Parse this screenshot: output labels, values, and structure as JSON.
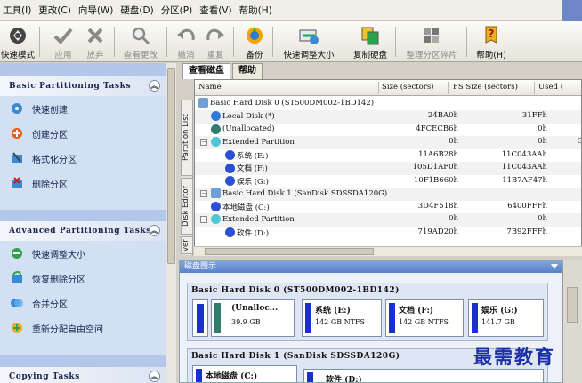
{
  "menu": [
    "工具(I)",
    "更改(C)",
    "向导(W)",
    "硬盘(D)",
    "分区(P)",
    "查看(V)",
    "帮助(H)"
  ],
  "toolbar": {
    "quick_mode": "快速模式",
    "apply": "应用",
    "discard": "放弃",
    "view_changes": "查看更改",
    "undo": "撤消",
    "redo": "重复",
    "backup": "备份",
    "quick_resize": "快速调整大小",
    "copy_disk": "复制硬盘",
    "defrag": "整理分区碎片",
    "help": "帮助(H)"
  },
  "left": {
    "basic": {
      "title": "Basic Partitioning Tasks",
      "items": [
        "快速创建",
        "创建分区",
        "格式化分区",
        "删除分区"
      ]
    },
    "advanced": {
      "title": "Advanced Partitioning Tasks",
      "items": [
        "快速调整大小",
        "恢复删除分区",
        "合并分区",
        "重新分配自由空间"
      ]
    },
    "copying": {
      "title": "Copying Tasks"
    }
  },
  "tabs": {
    "view_disk": "查看磁盘",
    "help": "帮助"
  },
  "vtabs": {
    "partition_list": "Partition List",
    "disk_editor": "Disk Editor",
    "partial": "ver"
  },
  "list": {
    "headers": {
      "name": "Name",
      "size": "Size (sectors)",
      "fs_size": "FS Size (sectors)",
      "used": "Used ("
    },
    "rows": [
      {
        "name": "Basic Hard Disk 0  (ST500DM002-1BD142)",
        "size": "",
        "fs": "",
        "used": ""
      },
      {
        "name": "Local Disk (*)",
        "size": "24BA0h",
        "fs": "31FFh",
        "used": ""
      },
      {
        "name": "(Unallocated)",
        "size": "4FCECB6h",
        "fs": "0h",
        "used": ""
      },
      {
        "name": "Extended Partition",
        "size": "0h",
        "fs": "0h",
        "used": "3"
      },
      {
        "name": "系统  (E:)",
        "size": "11A6B28h",
        "fs": "11C043AAh",
        "used": ""
      },
      {
        "name": "文档  (F:)",
        "size": "105D1AF0h",
        "fs": "11C043AAh",
        "used": ""
      },
      {
        "name": "娱乐  (G:)",
        "size": "10F1B660h",
        "fs": "11B7AF47h",
        "used": ""
      },
      {
        "name": "Basic Hard Disk 1  (SanDisk SDSSDA120G)",
        "size": "",
        "fs": "",
        "used": ""
      },
      {
        "name": "本地磁盘  (C:)",
        "size": "3D4F518h",
        "fs": "6400FFFh",
        "used": ""
      },
      {
        "name": "Extended Partition",
        "size": "0h",
        "fs": "0h",
        "used": ""
      },
      {
        "name": "软件  (D:)",
        "size": "719AD20h",
        "fs": "7B92FFFh",
        "used": ""
      }
    ]
  },
  "diskmap": {
    "title": "磁盘图示",
    "disk0": {
      "label": "Basic Hard Disk 0  (ST500DM002-1BD142)",
      "partitions": [
        {
          "name": "(Unalloc...",
          "size": "39.9 GB"
        },
        {
          "name": "系统  (E:)",
          "size": "142 GB NTFS"
        },
        {
          "name": "文档  (F:)",
          "size": "142 GB NTFS"
        },
        {
          "name": "娱乐  (G:)",
          "size": "141.7 GB"
        }
      ]
    },
    "disk1": {
      "label": "Basic Hard Disk 1  (SanDisk SDSSDA120G)",
      "partitions": [
        {
          "name": "本地磁盘  (C:)",
          "size": ""
        },
        {
          "name": "软件  (D:)",
          "size": ""
        }
      ]
    }
  },
  "watermark": "最需教育",
  "colors": {
    "accent": "#5a82c8",
    "partition_bar": "#1a2fd0",
    "unalloc_bar": "#2e7d6e"
  }
}
